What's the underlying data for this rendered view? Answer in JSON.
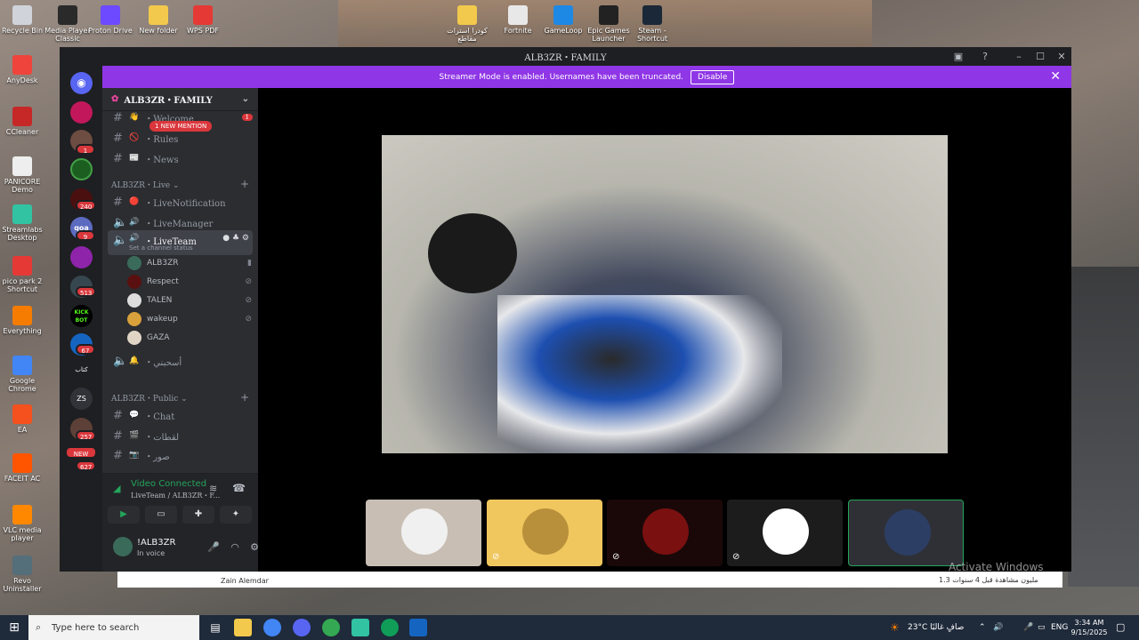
{
  "desktop": {
    "icons": [
      {
        "label": "Recycle Bin",
        "color": "#d0d4da"
      },
      {
        "label": "Media Player Classic",
        "color": "#2a2a2a"
      },
      {
        "label": "Proton Drive",
        "color": "#6d4aff"
      },
      {
        "label": "New folder",
        "color": "#f2c94c"
      },
      {
        "label": "WPS PDF",
        "color": "#e53935"
      },
      {
        "label": "كودرا استرات مقاطع",
        "color": "#f2c94c"
      },
      {
        "label": "Fortnite",
        "color": "#e8e8e8"
      },
      {
        "label": "GameLoop",
        "color": "#1e88e5"
      },
      {
        "label": "Epic Games Launcher",
        "color": "#222"
      },
      {
        "label": "Steam - Shortcut",
        "color": "#1b2838"
      },
      {
        "label": "AnyDesk",
        "color": "#ef443b"
      },
      {
        "label": "CCleaner",
        "color": "#c62828"
      },
      {
        "label": "PANICORE Demo",
        "color": "#eeeeee"
      },
      {
        "label": "Streamlabs Desktop",
        "color": "#31c3a2"
      },
      {
        "label": "pico park 2 Shortcut",
        "color": "#e53935"
      },
      {
        "label": "Everything",
        "color": "#f57c00"
      },
      {
        "label": "Google Chrome",
        "color": "#4285f4"
      },
      {
        "label": "EA",
        "color": "#f4511e"
      },
      {
        "label": "FACEIT AC",
        "color": "#ff5500"
      },
      {
        "label": "VLC media player",
        "color": "#ff8800"
      },
      {
        "label": "Revo Uninstaller",
        "color": "#546e7a"
      }
    ]
  },
  "window": {
    "title": "ALB3ZR・FAMILY",
    "banner": {
      "text": "Streamer Mode is enabled. Usernames have been truncated.",
      "button": "Disable"
    }
  },
  "rail": {
    "badges": [
      "1",
      "240",
      "9",
      "513",
      "67",
      "257",
      "627"
    ],
    "labels": {
      "new": "NEW",
      "zs": "ZS",
      "kick": "KICK BOT",
      "qoa": "qoa",
      "arabic": "كتاب"
    }
  },
  "sidebar": {
    "server_name": "ALB3ZR・FAMILY",
    "mention": "1 NEW MENTION",
    "top_channels": [
      {
        "name": "・Welcome",
        "emoji": "👋",
        "badge": "1"
      },
      {
        "name": "・Rules",
        "emoji": "🚫"
      },
      {
        "name": "・News",
        "emoji": "📰"
      }
    ],
    "cat_live": "ALB3ZR・Live",
    "live_channels": [
      {
        "name": "・LiveNotification",
        "emoji": "🔴",
        "type": "text"
      },
      {
        "name": "・LiveManager",
        "emoji": "🔊",
        "type": "voice"
      },
      {
        "name": "・LiveTeam",
        "emoji": "🔊",
        "type": "voice",
        "status": "Set a channel status"
      }
    ],
    "voice_users": [
      {
        "name": "ALB3ZR",
        "color": "#3a6b5a"
      },
      {
        "name": "Respect",
        "color": "#5a1010"
      },
      {
        "name": "TALEN",
        "color": "#dddddd"
      },
      {
        "name": "wakeup",
        "color": "#d9a13b"
      },
      {
        "name": "GAZA",
        "color": "#e0d5c5"
      }
    ],
    "arabic_voice": "・أسحبني",
    "cat_public": "ALB3ZR・Public",
    "public_channels": [
      {
        "name": "・Chat",
        "emoji": "💬"
      },
      {
        "name": "・لقطات",
        "emoji": "🎬"
      },
      {
        "name": "・صور",
        "emoji": "📷"
      }
    ]
  },
  "voice_panel": {
    "title": "Video Connected",
    "subtitle": "LiveTeam / ALB3ZR・F..."
  },
  "user_panel": {
    "name": "!ALB3ZR",
    "status": "In voice"
  },
  "stage": {
    "tiles": [
      {
        "bg": "#c8beb3",
        "avatar": "#f0f0f0",
        "muted": false
      },
      {
        "bg": "#f0c65e",
        "avatar": "#b8903b",
        "muted": true
      },
      {
        "bg": "#1a0808",
        "avatar": "#7a1010",
        "muted": true
      },
      {
        "bg": "#1c1c1c",
        "avatar": "#ffffff",
        "muted": true
      },
      {
        "bg": "#2f3036",
        "avatar": "#2c3e63",
        "muted": false,
        "active": true
      }
    ]
  },
  "overlay": {
    "name": "Zain Alemdar",
    "arabic": "1.3 مليون مشاهدة قبل 4 سنوات",
    "watermark": "Activate Windows"
  },
  "taskbar": {
    "search_placeholder": "Type here to search",
    "weather": "23°C صافٍ غالبًا",
    "lang": "ENG",
    "time": "3:34 AM",
    "date": "9/15/2025"
  }
}
